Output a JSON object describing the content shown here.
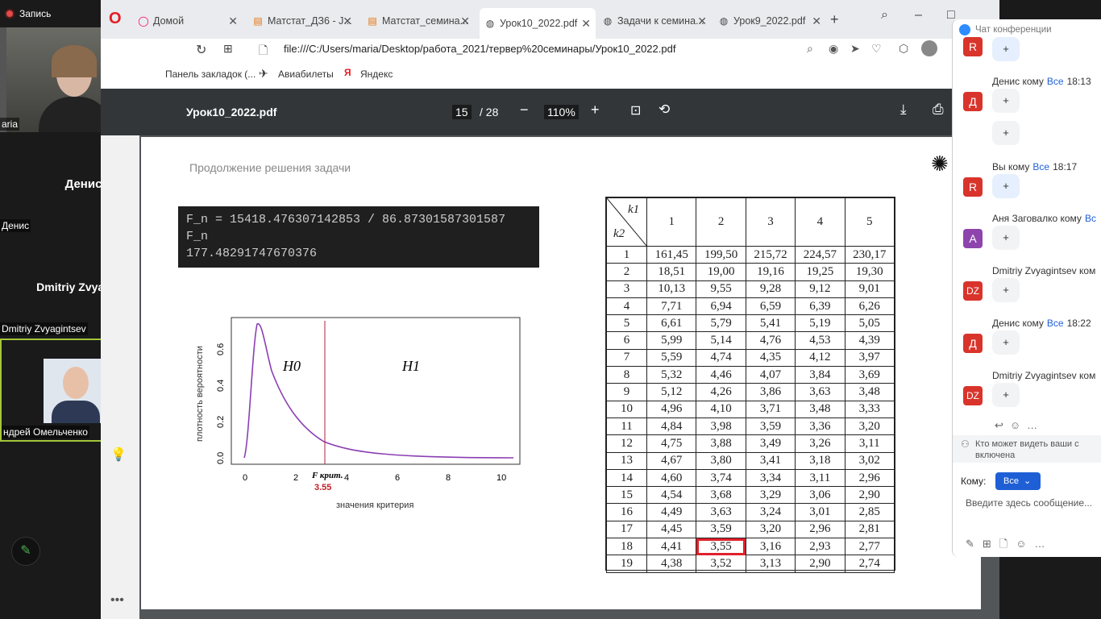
{
  "zoom": {
    "record_label": "Запись",
    "tiles": [
      {
        "name": "aria"
      },
      {
        "title": "Денис",
        "name": "Денис"
      },
      {
        "title": "Dmitriy  Zvyagin...",
        "name": "Dmitriy Zvyagintsev"
      },
      {
        "name": "ндрей Омельченко"
      }
    ]
  },
  "browser": {
    "tabs": [
      "Домой",
      "Матстат_ДЗ6 - J...",
      "Матстат_семина...",
      "Урок10_2022.pdf",
      "Задачи к семина...",
      "Урок9_2022.pdf"
    ],
    "url": "file:///C:/Users/maria/Desktop/работа_2021/тервер%20семинары/Урок10_2022.pdf",
    "bookmarks": [
      "Панель закладок (...",
      "Авиабилеты",
      "Яндекс"
    ]
  },
  "pdf": {
    "filename": "Урок10_2022.pdf",
    "page_current": "15",
    "page_total": "/ 28",
    "zoom": "110%"
  },
  "slide": {
    "subtitle": "Продолжение решения задачи",
    "code_lines": [
      "F_n = 15418.476307142853 / 86.87301587301587",
      "F_n",
      "177.48291747670376"
    ],
    "plot": {
      "ylabel": "плотность вероятности",
      "xlabel": "значения критерия",
      "h0": "H0",
      "h1": "H1",
      "fcrit_label": "F крит.",
      "fcrit_value": "3.55",
      "xticks": [
        "0",
        "2",
        "4",
        "6",
        "8",
        "10"
      ],
      "yticks": [
        "0.0",
        "0.2",
        "0.4",
        "0.6"
      ]
    },
    "table": {
      "k1": "k1",
      "k2": "k2",
      "header": [
        "1",
        "2",
        "3",
        "4",
        "5"
      ],
      "rows": [
        [
          "1",
          "161,45",
          "199,50",
          "215,72",
          "224,57",
          "230,17"
        ],
        [
          "2",
          "18,51",
          "19,00",
          "19,16",
          "19,25",
          "19,30"
        ],
        [
          "3",
          "10,13",
          "9,55",
          "9,28",
          "9,12",
          "9,01"
        ],
        [
          "4",
          "7,71",
          "6,94",
          "6,59",
          "6,39",
          "6,26"
        ],
        [
          "5",
          "6,61",
          "5,79",
          "5,41",
          "5,19",
          "5,05"
        ],
        [
          "6",
          "5,99",
          "5,14",
          "4,76",
          "4,53",
          "4,39"
        ],
        [
          "7",
          "5,59",
          "4,74",
          "4,35",
          "4,12",
          "3,97"
        ],
        [
          "8",
          "5,32",
          "4,46",
          "4,07",
          "3,84",
          "3,69"
        ],
        [
          "9",
          "5,12",
          "4,26",
          "3,86",
          "3,63",
          "3,48"
        ],
        [
          "10",
          "4,96",
          "4,10",
          "3,71",
          "3,48",
          "3,33"
        ],
        [
          "11",
          "4,84",
          "3,98",
          "3,59",
          "3,36",
          "3,20"
        ],
        [
          "12",
          "4,75",
          "3,88",
          "3,49",
          "3,26",
          "3,11"
        ],
        [
          "13",
          "4,67",
          "3,80",
          "3,41",
          "3,18",
          "3,02"
        ],
        [
          "14",
          "4,60",
          "3,74",
          "3,34",
          "3,11",
          "2,96"
        ],
        [
          "15",
          "4,54",
          "3,68",
          "3,29",
          "3,06",
          "2,90"
        ],
        [
          "16",
          "4,49",
          "3,63",
          "3,24",
          "3,01",
          "2,85"
        ],
        [
          "17",
          "4,45",
          "3,59",
          "3,20",
          "2,96",
          "2,81"
        ],
        [
          "18",
          "4,41",
          "3,55",
          "3,16",
          "2,93",
          "2,77"
        ],
        [
          "19",
          "4,38",
          "3,52",
          "3,13",
          "2,90",
          "2,74"
        ]
      ]
    }
  },
  "chat": {
    "title": "Чат конференции",
    "messages": [
      {
        "avatar": "R",
        "color": "#d9342b",
        "from": "",
        "to": "",
        "time": "",
        "bubbles": [
          "+"
        ]
      },
      {
        "avatar": "Д",
        "color": "#d9342b",
        "from": "Денис кому",
        "to": "Все",
        "time": "18:13",
        "bubbles": [
          "+",
          "+"
        ]
      },
      {
        "avatar": "R",
        "color": "#d9342b",
        "from": "Вы кому",
        "to": "Все",
        "time": "18:17",
        "bubbles": [
          "+"
        ]
      },
      {
        "avatar": "А",
        "color": "#8e44ad",
        "from": "Аня Заговалко кому",
        "to": "Вс",
        "time": "",
        "bubbles": [
          "+"
        ]
      },
      {
        "avatar": "DZ",
        "color": "#d9342b",
        "from": "Dmitriy Zvyagintsev ком",
        "to": "",
        "time": "",
        "bubbles": [
          "+"
        ]
      },
      {
        "avatar": "Д",
        "color": "#d9342b",
        "from": "Денис кому",
        "to": "Все",
        "time": "18:22",
        "bubbles": [
          "+"
        ]
      },
      {
        "avatar": "DZ",
        "color": "#d9342b",
        "from": "Dmitriy Zvyagintsev ком",
        "to": "",
        "time": "",
        "bubbles": [
          "+"
        ]
      }
    ],
    "visibility_note": "Кто может видеть ваши с включена",
    "to_label": "Кому:",
    "to_value": "Все",
    "input_placeholder": "Введите здесь сообщение..."
  }
}
